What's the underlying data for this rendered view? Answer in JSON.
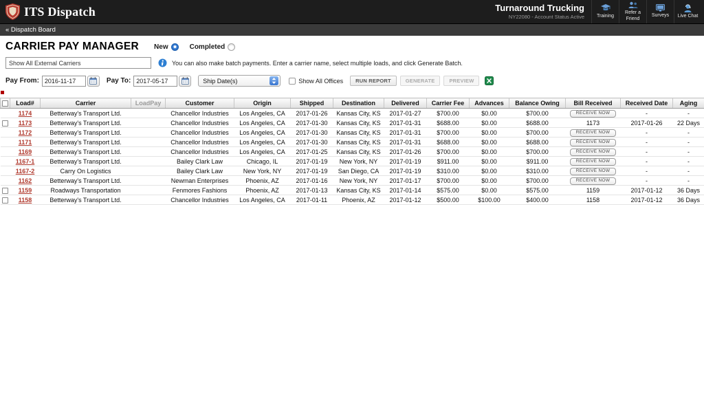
{
  "topbar": {
    "brand": "ITS Dispatch",
    "company": "Turnaround Trucking",
    "account_status": "NY22080 - Account Status Active",
    "nav": [
      {
        "label": "Training",
        "icon": "graduation-cap-icon"
      },
      {
        "label": "Refer a Friend",
        "icon": "people-icon"
      },
      {
        "label": "Surveys",
        "icon": "monitor-icon"
      },
      {
        "label": "Live Chat",
        "icon": "headset-icon"
      }
    ]
  },
  "breadcrumb": {
    "label": "« Dispatch Board"
  },
  "toolbar": {
    "title": "CARRIER PAY MANAGER",
    "radio_new": "New",
    "radio_completed": "Completed",
    "carrier_search_value": "Show All External Carriers",
    "hint": "You can also make batch payments. Enter a carrier name, select multiple loads, and click Generate Batch.",
    "pay_from_label": "Pay From:",
    "pay_from": "2016-11-17",
    "pay_to_label": "Pay To:",
    "pay_to": "2017-05-17",
    "date_type": "Ship Date(s)",
    "show_all_offices": "Show All Offices",
    "run_report": "RUN REPORT",
    "generate": "GENERATE",
    "preview": "PREVIEW",
    "receive_now": "RECEIVE NOW"
  },
  "table": {
    "headers": [
      "Load#",
      "Carrier",
      "LoadPay",
      "Customer",
      "Origin",
      "Shipped",
      "Destination",
      "Delivered",
      "Carrier Fee",
      "Advances",
      "Balance Owing",
      "Bill Received",
      "Received Date",
      "Aging"
    ],
    "rows": [
      {
        "selectable": false,
        "load": "1174",
        "carrier": "Betterway's Transport Ltd.",
        "loadpay": "",
        "customer": "Chancellor Industries",
        "origin": "Los Angeles, CA",
        "shipped": "2017-01-26",
        "destination": "Kansas City, KS",
        "delivered": "2017-01-27",
        "carrier_fee": "$700.00",
        "advances": "$0.00",
        "balance_owing": "$700.00",
        "bill_received": "",
        "received_date": "-",
        "aging": "-"
      },
      {
        "selectable": true,
        "load": "1173",
        "carrier": "Betterway's Transport Ltd.",
        "loadpay": "",
        "customer": "Chancellor Industries",
        "origin": "Los Angeles, CA",
        "shipped": "2017-01-30",
        "destination": "Kansas City, KS",
        "delivered": "2017-01-31",
        "carrier_fee": "$688.00",
        "advances": "$0.00",
        "balance_owing": "$688.00",
        "bill_received": "1173",
        "received_date": "2017-01-26",
        "aging": "22 Days"
      },
      {
        "selectable": false,
        "load": "1172",
        "carrier": "Betterway's Transport Ltd.",
        "loadpay": "",
        "customer": "Chancellor Industries",
        "origin": "Los Angeles, CA",
        "shipped": "2017-01-30",
        "destination": "Kansas City, KS",
        "delivered": "2017-01-31",
        "carrier_fee": "$700.00",
        "advances": "$0.00",
        "balance_owing": "$700.00",
        "bill_received": "",
        "received_date": "-",
        "aging": "-"
      },
      {
        "selectable": false,
        "load": "1171",
        "carrier": "Betterway's Transport Ltd.",
        "loadpay": "",
        "customer": "Chancellor Industries",
        "origin": "Los Angeles, CA",
        "shipped": "2017-01-30",
        "destination": "Kansas City, KS",
        "delivered": "2017-01-31",
        "carrier_fee": "$688.00",
        "advances": "$0.00",
        "balance_owing": "$688.00",
        "bill_received": "",
        "received_date": "-",
        "aging": "-"
      },
      {
        "selectable": false,
        "load": "1169",
        "carrier": "Betterway's Transport Ltd.",
        "loadpay": "",
        "customer": "Chancellor Industries",
        "origin": "Los Angeles, CA",
        "shipped": "2017-01-25",
        "destination": "Kansas City, KS",
        "delivered": "2017-01-26",
        "carrier_fee": "$700.00",
        "advances": "$0.00",
        "balance_owing": "$700.00",
        "bill_received": "",
        "received_date": "-",
        "aging": "-"
      },
      {
        "selectable": false,
        "load": "1167-1",
        "carrier": "Betterway's Transport Ltd.",
        "loadpay": "",
        "customer": "Bailey Clark Law",
        "origin": "Chicago, IL",
        "shipped": "2017-01-19",
        "destination": "New York, NY",
        "delivered": "2017-01-19",
        "carrier_fee": "$911.00",
        "advances": "$0.00",
        "balance_owing": "$911.00",
        "bill_received": "",
        "received_date": "-",
        "aging": "-"
      },
      {
        "selectable": false,
        "load": "1167-2",
        "carrier": "Carry On Logistics",
        "loadpay": "",
        "customer": "Bailey Clark Law",
        "origin": "New York, NY",
        "shipped": "2017-01-19",
        "destination": "San Diego, CA",
        "delivered": "2017-01-19",
        "carrier_fee": "$310.00",
        "advances": "$0.00",
        "balance_owing": "$310.00",
        "bill_received": "",
        "received_date": "-",
        "aging": "-"
      },
      {
        "selectable": false,
        "load": "1162",
        "carrier": "Betterway's Transport Ltd.",
        "loadpay": "",
        "customer": "Newman Enterprises",
        "origin": "Phoenix, AZ",
        "shipped": "2017-01-16",
        "destination": "New York, NY",
        "delivered": "2017-01-17",
        "carrier_fee": "$700.00",
        "advances": "$0.00",
        "balance_owing": "$700.00",
        "bill_received": "",
        "received_date": "-",
        "aging": "-"
      },
      {
        "selectable": true,
        "load": "1159",
        "carrier": "Roadways Transportation",
        "loadpay": "",
        "customer": "Fenmores Fashions",
        "origin": "Phoenix, AZ",
        "shipped": "2017-01-13",
        "destination": "Kansas City, KS",
        "delivered": "2017-01-14",
        "carrier_fee": "$575.00",
        "advances": "$0.00",
        "balance_owing": "$575.00",
        "bill_received": "1159",
        "received_date": "2017-01-12",
        "aging": "36 Days"
      },
      {
        "selectable": true,
        "load": "1158",
        "carrier": "Betterway's Transport Ltd.",
        "loadpay": "",
        "customer": "Chancellor Industries",
        "origin": "Los Angeles, CA",
        "shipped": "2017-01-11",
        "destination": "Phoenix, AZ",
        "delivered": "2017-01-12",
        "carrier_fee": "$500.00",
        "advances": "$100.00",
        "balance_owing": "$400.00",
        "bill_received": "1158",
        "received_date": "2017-01-12",
        "aging": "36 Days"
      }
    ]
  },
  "colors": {
    "brand_red": "#b8392e",
    "load_link_red": "#b03a2e",
    "accent_blue": "#2d7fd3",
    "excel_green": "#1f8a4c",
    "topbar_dark": "#1d1d1d"
  }
}
